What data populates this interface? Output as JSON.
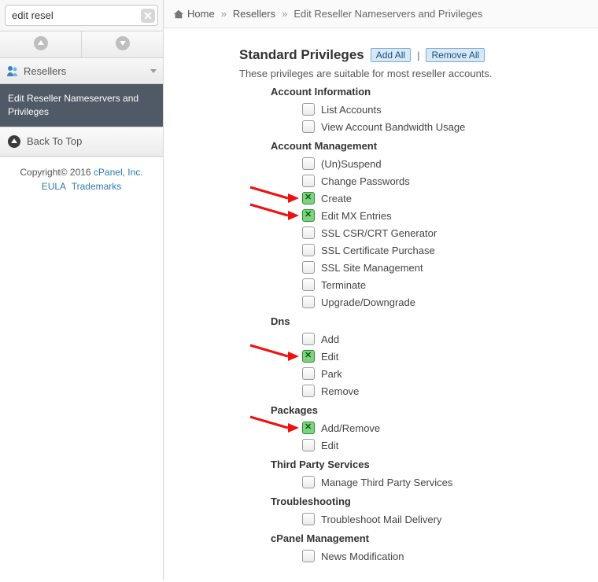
{
  "search": {
    "value": "edit resel",
    "placeholder": ""
  },
  "sidebar": {
    "section": "Resellers",
    "item": "Edit Reseller Nameservers and Privileges",
    "back": "Back To Top"
  },
  "footer": {
    "copyright": "Copyright© 2016 ",
    "brand": "cPanel, Inc.",
    "eula": "EULA",
    "trademarks": "Trademarks"
  },
  "breadcrumbs": {
    "home": "Home",
    "level1": "Resellers",
    "level2": "Edit Reseller Nameservers and Privileges"
  },
  "privileges": {
    "title": "Standard Privileges",
    "addAll": "Add All",
    "removeAll": "Remove All",
    "subtext": "These privileges are suitable for most reseller accounts.",
    "groups": [
      {
        "name": "Account Information",
        "items": [
          {
            "label": "List Accounts",
            "checked": false
          },
          {
            "label": "View Account Bandwidth Usage",
            "checked": false
          }
        ]
      },
      {
        "name": "Account Management",
        "items": [
          {
            "label": "(Un)Suspend",
            "checked": false
          },
          {
            "label": "Change Passwords",
            "checked": false
          },
          {
            "label": "Create",
            "checked": true,
            "arrow": true
          },
          {
            "label": "Edit MX Entries",
            "checked": true,
            "arrow": true
          },
          {
            "label": "SSL CSR/CRT Generator",
            "checked": false
          },
          {
            "label": "SSL Certificate Purchase",
            "checked": false
          },
          {
            "label": "SSL Site Management",
            "checked": false
          },
          {
            "label": "Terminate",
            "checked": false
          },
          {
            "label": "Upgrade/Downgrade",
            "checked": false
          }
        ]
      },
      {
        "name": "Dns",
        "items": [
          {
            "label": "Add",
            "checked": false
          },
          {
            "label": "Edit",
            "checked": true,
            "arrow": true
          },
          {
            "label": "Park",
            "checked": false
          },
          {
            "label": "Remove",
            "checked": false
          }
        ]
      },
      {
        "name": "Packages",
        "items": [
          {
            "label": "Add/Remove",
            "checked": true,
            "arrow": true
          },
          {
            "label": "Edit",
            "checked": false
          }
        ]
      },
      {
        "name": "Third Party Services",
        "items": [
          {
            "label": "Manage Third Party Services",
            "checked": false
          }
        ]
      },
      {
        "name": "Troubleshooting",
        "items": [
          {
            "label": "Troubleshoot Mail Delivery",
            "checked": false
          }
        ]
      },
      {
        "name": "cPanel Management",
        "items": [
          {
            "label": "News Modification",
            "checked": false
          }
        ]
      }
    ]
  }
}
